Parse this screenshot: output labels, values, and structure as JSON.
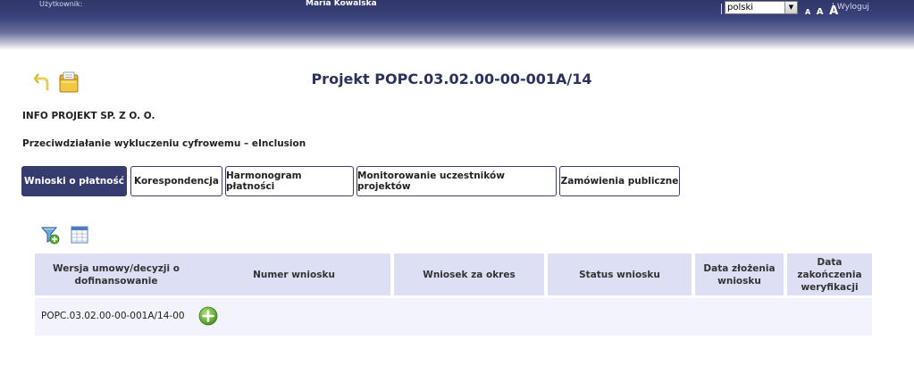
{
  "header": {
    "user_label": "Użytkownik:",
    "user_name": "Maria Kowalska",
    "language_selected": "polski",
    "font_size_small": "A",
    "font_size_medium": "A",
    "font_size_large": "A",
    "separator": "|",
    "logout_label": "Wyloguj"
  },
  "toolbar_icons": [
    "back-icon",
    "folder-icon"
  ],
  "project": {
    "title": "Projekt POPC.03.02.00-00-001A/14",
    "beneficiary": "INFO PROJEKT SP. Z O. O.",
    "name": "Przeciwdziałanie wykluczeniu cyfrowemu – eInclusion"
  },
  "tabs": [
    {
      "label": "Wnioski o płatność",
      "active": true
    },
    {
      "label": "Korespondencja",
      "active": false
    },
    {
      "label": "Harmonogram płatności",
      "active": false
    },
    {
      "label": "Monitorowanie uczestników projektów",
      "active": false
    },
    {
      "label": "Zamówienia publiczne",
      "active": false
    }
  ],
  "table_tools": [
    "filter-add-icon",
    "columns-icon"
  ],
  "table": {
    "columns": [
      "Wersja umowy/decyzji o dofinansowanie",
      "Numer wniosku",
      "Wniosek za okres",
      "Status wniosku",
      "Data złożenia wniosku",
      "Data zakończenia weryfikacji"
    ],
    "rows": [
      {
        "agreement_version": "POPC.03.02.00-00-001A/14-00",
        "action": "add-icon"
      }
    ]
  },
  "colors": {
    "header_dark": "#2f3669",
    "tab_active": "#363c6d",
    "title_text": "#2c3160",
    "table_header_bg": "#dde0f4",
    "add_button": "#6db33f"
  }
}
